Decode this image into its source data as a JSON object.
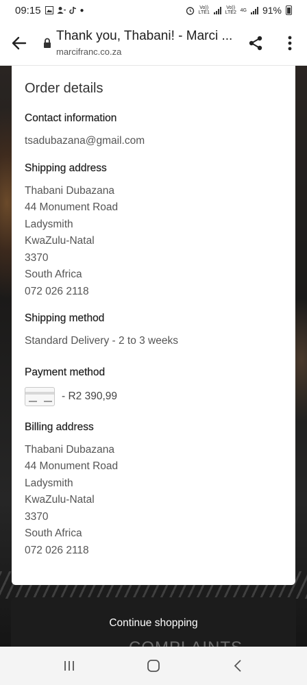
{
  "status_bar": {
    "time": "09:15",
    "net1": "Vo)) LTE1",
    "net2": "Vo)) LTE2",
    "net_type": "4G",
    "battery": "91%"
  },
  "browser": {
    "page_title": "Thank you, Thabani! - Marci ...",
    "domain": "marcifranc.co.za"
  },
  "order": {
    "heading": "Order details",
    "contact": {
      "title": "Contact information",
      "email": "tsadubazana@gmail.com"
    },
    "shipping_address": {
      "title": "Shipping address",
      "lines": [
        "Thabani Dubazana",
        "44 Monument Road",
        "Ladysmith",
        "KwaZulu-Natal",
        "3370",
        "South Africa",
        "072 026 2118"
      ]
    },
    "shipping_method": {
      "title": "Shipping method",
      "value": "Standard Delivery - 2 to 3 weeks"
    },
    "payment_method": {
      "title": "Payment method",
      "amount": "- R2 390,99"
    },
    "billing_address": {
      "title": "Billing address",
      "lines": [
        "Thabani Dubazana",
        "44 Monument Road",
        "Ladysmith",
        "KwaZulu-Natal",
        "3370",
        "South Africa",
        "072 026 2118"
      ]
    }
  },
  "actions": {
    "continue_label": "Continue shopping"
  },
  "watermark": "COMPLAINTS"
}
